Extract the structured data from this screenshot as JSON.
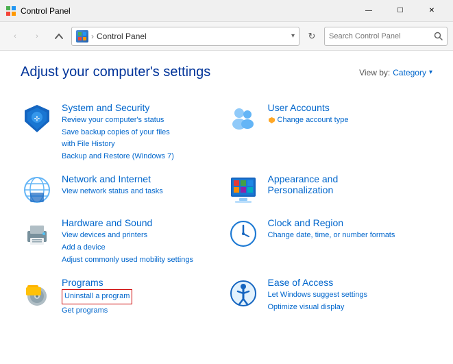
{
  "titlebar": {
    "icon": "⊞",
    "title": "Control Panel",
    "minimize": "—",
    "maximize": "☐",
    "close": "✕"
  },
  "navbar": {
    "back": "‹",
    "forward": "›",
    "up": "↑",
    "address_icon": "⊞",
    "address_text": "Control Panel",
    "dropdown": "▾",
    "refresh": "↻",
    "search_placeholder": "Search Control Panel",
    "search_icon": "🔍"
  },
  "main": {
    "title": "Adjust your computer's settings",
    "viewby_label": "View by:",
    "viewby_value": "Category",
    "categories": [
      {
        "id": "system-security",
        "title": "System and Security",
        "links": [
          "Review your computer's status",
          "Save backup copies of your files with File History",
          "Backup and Restore (Windows 7)"
        ]
      },
      {
        "id": "user-accounts",
        "title": "User Accounts",
        "links": [
          "Change account type"
        ]
      },
      {
        "id": "network-internet",
        "title": "Network and Internet",
        "links": [
          "View network status and tasks"
        ]
      },
      {
        "id": "appearance",
        "title": "Appearance and Personalization",
        "links": []
      },
      {
        "id": "hardware-sound",
        "title": "Hardware and Sound",
        "links": [
          "View devices and printers",
          "Add a device",
          "Adjust commonly used mobility settings"
        ]
      },
      {
        "id": "clock-region",
        "title": "Clock and Region",
        "links": [
          "Change date, time, or number formats"
        ]
      },
      {
        "id": "programs",
        "title": "Programs",
        "links": [
          "Uninstall a program",
          "Get programs"
        ]
      },
      {
        "id": "ease-access",
        "title": "Ease of Access",
        "links": [
          "Let Windows suggest settings",
          "Optimize visual display"
        ]
      }
    ]
  }
}
